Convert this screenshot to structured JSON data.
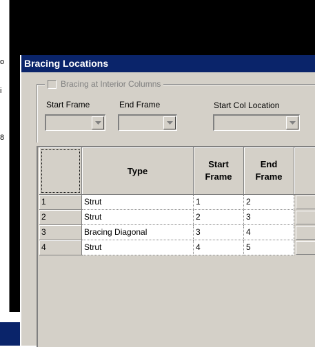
{
  "background": {
    "left_chars": [
      "o",
      "i",
      "8"
    ]
  },
  "dialog": {
    "title": "Bracing Locations",
    "group": {
      "checkbox_label": "Bracing at Interior Columns",
      "checked": false
    },
    "fields": {
      "start_frame_label": "Start Frame",
      "end_frame_label": "End Frame",
      "start_col_location_label": "Start Col Location",
      "start_frame_value": "",
      "end_frame_value": "",
      "start_col_location_value": ""
    },
    "grid": {
      "columns": [
        "",
        "Type",
        "Start\nFrame",
        "End\nFrame",
        ""
      ],
      "rows": [
        {
          "num": "1",
          "type": "Strut",
          "start": "1",
          "end": "2"
        },
        {
          "num": "2",
          "type": "Strut",
          "start": "2",
          "end": "3"
        },
        {
          "num": "3",
          "type": "Bracing Diagonal",
          "start": "3",
          "end": "4"
        },
        {
          "num": "4",
          "type": "Strut",
          "start": "4",
          "end": "5"
        }
      ]
    }
  },
  "colors": {
    "titlebar": "#0a246a",
    "face": "#d4d0c8"
  }
}
